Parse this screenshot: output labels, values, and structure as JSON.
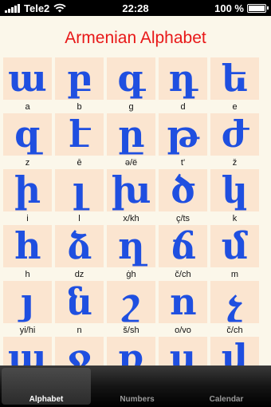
{
  "status_bar": {
    "carrier": "Tele2",
    "time": "22:28",
    "battery": "100 %",
    "battery_level": 1.0,
    "icons": [
      "signal-icon",
      "wifi-icon",
      "battery-icon"
    ]
  },
  "title": "Armenian Alphabet",
  "letters": [
    {
      "glyph": "ա",
      "translit": "a"
    },
    {
      "glyph": "բ",
      "translit": "b"
    },
    {
      "glyph": "գ",
      "translit": "g"
    },
    {
      "glyph": "դ",
      "translit": "d"
    },
    {
      "glyph": "ե",
      "translit": "e"
    },
    {
      "glyph": "զ",
      "translit": "z"
    },
    {
      "glyph": "է",
      "translit": "ē"
    },
    {
      "glyph": "ը",
      "translit": "ə/ë"
    },
    {
      "glyph": "թ",
      "translit": "t'"
    },
    {
      "glyph": "ժ",
      "translit": "ž"
    },
    {
      "glyph": "ի",
      "translit": "i"
    },
    {
      "glyph": "լ",
      "translit": "l"
    },
    {
      "glyph": "խ",
      "translit": "x/kh"
    },
    {
      "glyph": "ծ",
      "translit": "ç/ts"
    },
    {
      "glyph": "կ",
      "translit": "k"
    },
    {
      "glyph": "հ",
      "translit": "h"
    },
    {
      "glyph": "ձ",
      "translit": "dz"
    },
    {
      "glyph": "ղ",
      "translit": "ġh"
    },
    {
      "glyph": "ճ",
      "translit": "č/ch"
    },
    {
      "glyph": "մ",
      "translit": "m"
    },
    {
      "glyph": "յ",
      "translit": "yi/hi"
    },
    {
      "glyph": "ն",
      "translit": "n"
    },
    {
      "glyph": "շ",
      "translit": "š/sh"
    },
    {
      "glyph": "ո",
      "translit": "o/vo"
    },
    {
      "glyph": "չ",
      "translit": "č/ch"
    },
    {
      "glyph": "պ",
      "translit": ""
    },
    {
      "glyph": "ջ",
      "translit": ""
    },
    {
      "glyph": "ռ",
      "translit": ""
    },
    {
      "glyph": "ս",
      "translit": ""
    },
    {
      "glyph": "վ",
      "translit": ""
    }
  ],
  "tabs": [
    {
      "label": "Alphabet",
      "active": true
    },
    {
      "label": "Numbers",
      "active": false
    },
    {
      "label": "Calendar",
      "active": false
    }
  ],
  "colors": {
    "title": "#e81818",
    "glyph": "#1f4fe0",
    "cell_background": "#fbe5d0",
    "page_background": "#fbf7ea"
  }
}
